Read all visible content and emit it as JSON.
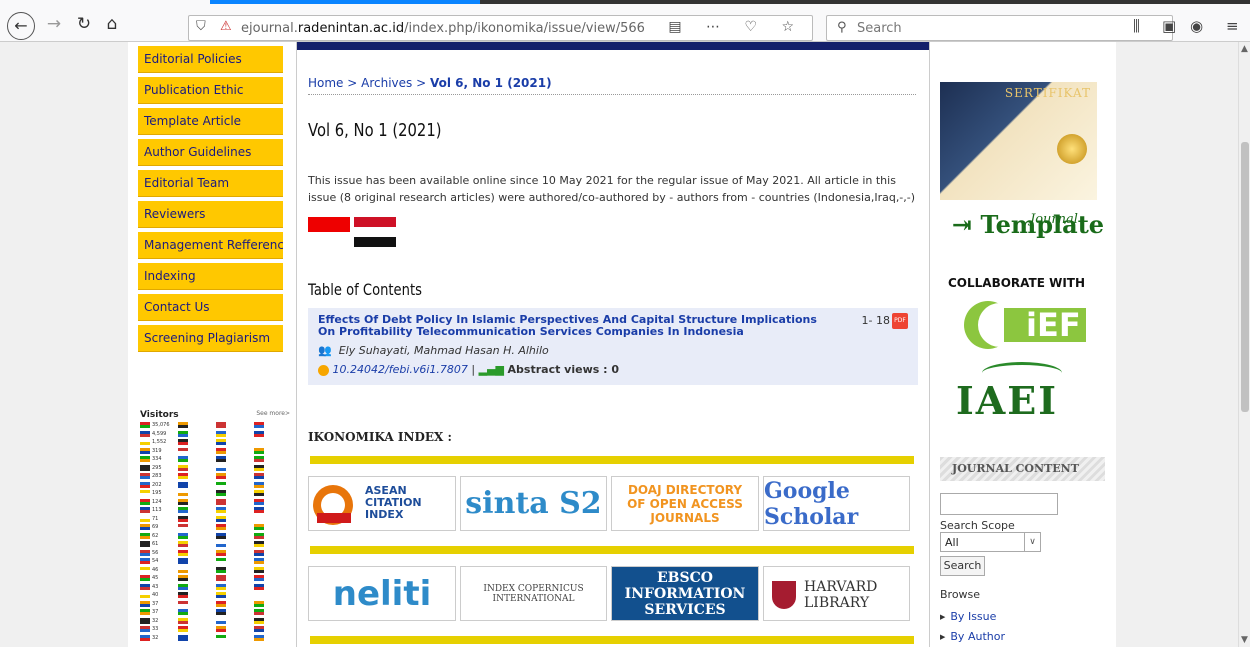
{
  "browser": {
    "url_prefix": "ejournal.",
    "url_domain": "radenintan.ac.id",
    "url_path": "/index.php/ikonomika/issue/view/566",
    "search_placeholder": "Search"
  },
  "left_menu": [
    "Editorial Policies",
    "Publication Ethic",
    "Template Article",
    "Author Guidelines",
    "Editorial Team",
    "Reviewers",
    "Management Refference",
    "Indexing",
    "Contact Us",
    "Screening Plagiarism"
  ],
  "visitors": {
    "title": "Visitors",
    "more": "See more>",
    "counts": [
      "35,076",
      "4,599",
      "1,552",
      "319",
      "334",
      "295",
      "283",
      "202",
      "195",
      "124",
      "113",
      "71",
      "69",
      "62",
      "61",
      "56",
      "54",
      "46",
      "45",
      "43",
      "40",
      "37",
      "37",
      "32",
      "33",
      "32"
    ]
  },
  "breadcrumb": {
    "home": "Home",
    "archives": "Archives",
    "current": "Vol 6, No 1 (2021)"
  },
  "issue": {
    "title": "Vol 6, No 1 (2021)",
    "description": "This issue has been available online since 10 May 2021 for the regular issue of May 2021. All article in this issue (8 original research articles) were authored/co-authored by - authors from - countries (Indonesia,Iraq,-,-)"
  },
  "toc": {
    "title": "Table of Contents",
    "article": {
      "title": "Effects Of Debt Policy In Islamic Perspectives And Capital Structure Implications On Profitability Telecommunication Services Companies In Indonesia",
      "pages": "1- 18",
      "authors": "Ely Suhayati, Mahmad Hasan H. Alhilo",
      "doi": "10.24042/febi.v6i1.7807",
      "separator": "|",
      "views": "Abstract views : 0"
    }
  },
  "index": {
    "title": "IKONOMIKA INDEX :",
    "logos": [
      "ASEAN CITATION INDEX",
      "sinta S2",
      "DOAJ DIRECTORY OF OPEN ACCESS JOURNALS",
      "Google Scholar",
      "neliti",
      "INDEX COPERNICUS INTERNATIONAL",
      "EBSCO INFORMATION SERVICES",
      "HARVARD LIBRARY"
    ]
  },
  "right": {
    "cert_title": "SERTIFIKAT",
    "journal_template": "Template",
    "journal_small": "Journal",
    "collaborate": "COLLABORATE WITH",
    "ief": "iEF",
    "iaei": "IAEI",
    "journal_content": "JOURNAL CONTENT",
    "search_scope": "Search Scope",
    "scope_value": "All",
    "search_button": "Search",
    "browse": "Browse",
    "by_issue": "By Issue",
    "by_author": "By Author"
  },
  "colors": {
    "menu_yellow": "#ffc800",
    "link_blue": "#1a3da8",
    "nav_dark": "#14206b",
    "index_bar": "#e6d000"
  }
}
